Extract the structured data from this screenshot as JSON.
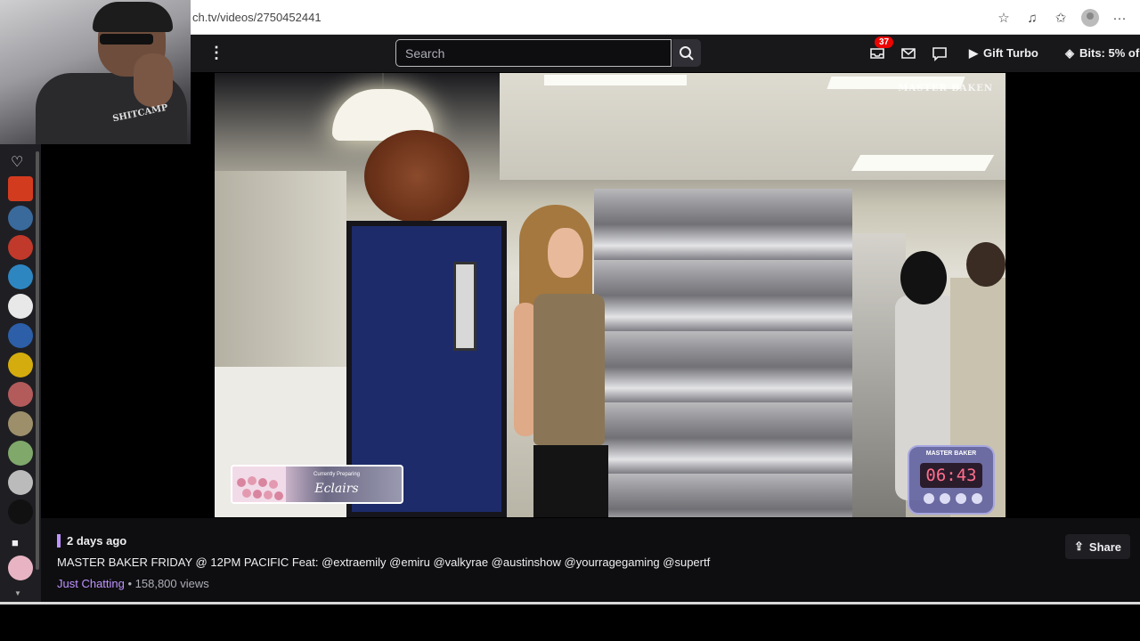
{
  "browser": {
    "url": "ch.tv/videos/2750452441",
    "icons": [
      "star-icon",
      "media-icon",
      "favorites-icon",
      "profile-icon",
      "more-icon"
    ]
  },
  "topnav": {
    "search_placeholder": "Search",
    "notification_count": "37",
    "gift_turbo_label": "Gift Turbo",
    "bits_label": "Bits: 5% of"
  },
  "webcam": {
    "shirt_text": "SHITCAMP"
  },
  "sidebar": {
    "items": [
      {
        "name": "sidebar-channel-1",
        "color": "#d33b1f"
      },
      {
        "name": "sidebar-channel-2",
        "color": "#3a6a9c"
      },
      {
        "name": "sidebar-channel-3",
        "color": "#c0392b"
      },
      {
        "name": "sidebar-channel-4",
        "color": "#2e86c1"
      },
      {
        "name": "sidebar-channel-5",
        "color": "#e8e8e8"
      },
      {
        "name": "sidebar-channel-6",
        "color": "#2c5fa8"
      },
      {
        "name": "sidebar-channel-7",
        "color": "#d4ac0d"
      },
      {
        "name": "sidebar-channel-8",
        "color": "#b35b5b"
      },
      {
        "name": "sidebar-channel-9",
        "color": "#9c8f6a"
      },
      {
        "name": "sidebar-channel-10",
        "color": "#7fa86a"
      },
      {
        "name": "sidebar-channel-11",
        "color": "#bbbbbb"
      },
      {
        "name": "sidebar-channel-12",
        "color": "#111111"
      },
      {
        "name": "sidebar-channel-13",
        "color": "#e8b4c4"
      }
    ]
  },
  "video": {
    "watermark": "MASTER BAKEN",
    "card_small": "Currently Preparing",
    "card_big": "Eclairs",
    "timer_label": "MASTER BAKER",
    "timer_value": "06:43"
  },
  "info": {
    "date": "2 days ago",
    "title": "MASTER BAKER FRIDAY @ 12PM PACIFIC Feat: @extraemily @emiru @valkyrae @austinshow @yourragegaming @supertf",
    "category": "Just Chatting",
    "views": " • 158,800 views",
    "share_label": "Share"
  },
  "colors": {
    "accent": "#bf94ff",
    "nav_bg": "#18181b",
    "badge": "#eb0400"
  }
}
